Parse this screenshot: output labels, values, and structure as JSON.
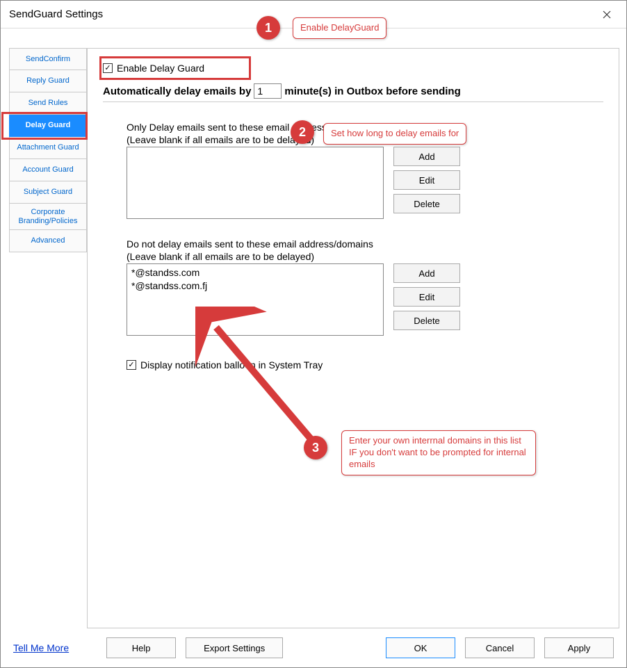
{
  "window": {
    "title": "SendGuard Settings"
  },
  "sidebar": {
    "tabs": [
      "SendConfirm",
      "Reply Guard",
      "Send Rules",
      "Delay Guard",
      "Attachment Guard",
      "Account Guard",
      "Subject Guard",
      "Corporate Branding/Policies",
      "Advanced"
    ],
    "active": "Delay Guard"
  },
  "content": {
    "enable_label": "Enable Delay Guard",
    "enable_checked": true,
    "delay_prefix": "Automatically delay emails by",
    "delay_minutes": "1",
    "delay_suffix": "minute(s) in Outbox before sending",
    "only_delay_label": "Only Delay emails sent to these email address/domains",
    "only_delay_sub": "(Leave blank if all emails are to be delayed)",
    "only_delay_items": [],
    "dont_delay_label": "Do not delay emails sent to these email address/domains",
    "dont_delay_sub": "(Leave blank if all emails are to be delayed)",
    "dont_delay_items": [
      "*@standss.com",
      "*@standss.com.fj"
    ],
    "buttons": {
      "add": "Add",
      "edit": "Edit",
      "delete": "Delete"
    },
    "notify_label": "Display notification balloon in System Tray",
    "notify_checked": true
  },
  "footer": {
    "tell_me_more": "Tell Me More",
    "help": "Help",
    "export": "Export Settings",
    "ok": "OK",
    "cancel": "Cancel",
    "apply": "Apply"
  },
  "annotations": {
    "b1": "1",
    "l1": "Enable DelayGuard",
    "b2": "2",
    "l2": "Set how long to delay emails for",
    "b3": "3",
    "l3": "Enter your own interrnal domains in this list IF you don't want to be prompted for internal emails"
  }
}
